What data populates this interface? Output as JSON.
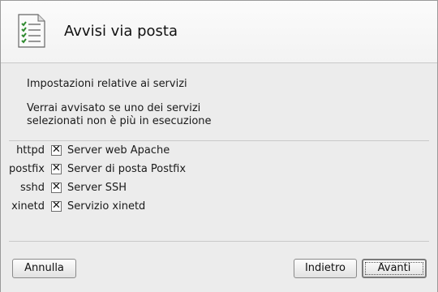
{
  "header": {
    "title": "Avvisi via posta",
    "icon": "checklist-icon"
  },
  "content": {
    "intro": "Impostazioni relative ai servizi",
    "notice_line1": "Verrai avvisato se uno dei servizi",
    "notice_line2": "selezionati non è più in esecuzione"
  },
  "services": [
    {
      "name": "httpd",
      "label": "Server web Apache",
      "checked": true
    },
    {
      "name": "postfix",
      "label": "Server di posta Postfix",
      "checked": true
    },
    {
      "name": "sshd",
      "label": "Server SSH",
      "checked": true
    },
    {
      "name": "xinetd",
      "label": "Servizio xinetd",
      "checked": true
    }
  ],
  "buttons": {
    "cancel": "Annulla",
    "back": "Indietro",
    "next": "Avanti"
  },
  "checkmark": "✕"
}
